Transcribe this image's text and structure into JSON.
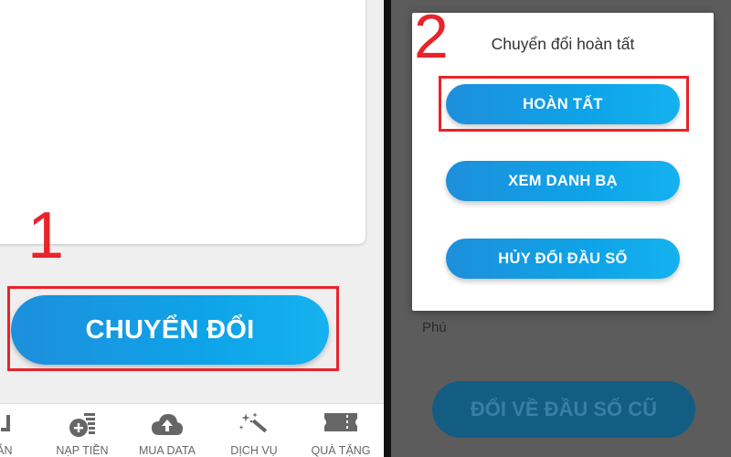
{
  "left_screen": {
    "step_number": "1",
    "convert_button_label": "CHUYỂN ĐỔI",
    "bottom_nav": [
      {
        "label": "OẢN",
        "icon": "account-icon"
      },
      {
        "label": "NẠP TIỀN",
        "icon": "topup-coins-icon"
      },
      {
        "label": "MUA DATA",
        "icon": "cloud-upload-icon"
      },
      {
        "label": "DỊCH VỤ",
        "icon": "magic-wand-icon"
      },
      {
        "label": "QUÀ TẶNG",
        "icon": "gift-ticket-icon"
      }
    ]
  },
  "right_screen": {
    "step_number": "2",
    "dialog": {
      "title": "Chuyển đổi hoàn tất",
      "done_label": "HOÀN TẤT",
      "contacts_label": "XEM DANH BẠ",
      "cancel_label": "HỦY ĐỔI ĐẦU SỐ"
    },
    "background_text": "Phú",
    "background_button_label": "ĐỔI VỀ ĐẦU SỐ CŨ"
  },
  "colors": {
    "accent_blue": "#0ea3e8",
    "highlight_red": "#e8232a",
    "overlay_gray": "#5c5c5c"
  }
}
